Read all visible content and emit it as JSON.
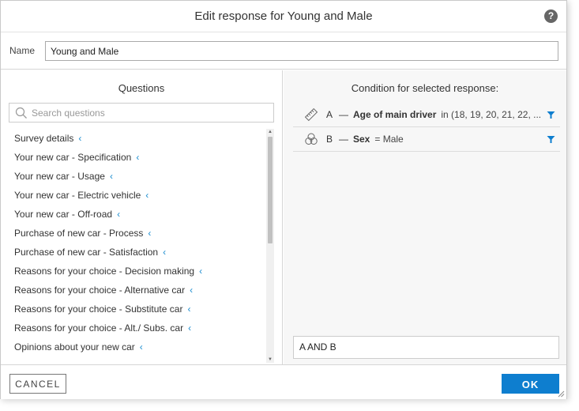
{
  "dialog": {
    "title": "Edit response for Young and Male",
    "help_icon": "?"
  },
  "name": {
    "label": "Name",
    "value": "Young and Male"
  },
  "questions": {
    "heading": "Questions",
    "search_placeholder": "Search questions",
    "items": [
      "Survey details",
      "Your new car - Specification",
      "Your new car - Usage",
      "Your new car - Electric vehicle",
      "Your new car - Off-road",
      "Purchase of new car - Process",
      "Purchase of new car - Satisfaction",
      "Reasons for your choice - Decision making",
      "Reasons for your choice - Alternative car",
      "Reasons for your choice - Substitute car",
      "Reasons for your choice - Alt./ Subs. car",
      "Opinions about your new car"
    ],
    "chevron": "‹"
  },
  "conditions": {
    "heading": "Condition for selected response:",
    "rows": [
      {
        "icon": "ruler-icon",
        "letter": "A",
        "dash": "—",
        "question": "Age of main driver",
        "value": "in (18, 19, 20, 21, 22, ..."
      },
      {
        "icon": "venn-icon",
        "letter": "B",
        "dash": "—",
        "question": "Sex",
        "value": "= Male"
      }
    ],
    "expression": "A AND B"
  },
  "footer": {
    "cancel_label": "CANCEL",
    "ok_label": "OK"
  },
  "colors": {
    "accent": "#0e7ecf",
    "chevron": "#1a8ccf"
  }
}
